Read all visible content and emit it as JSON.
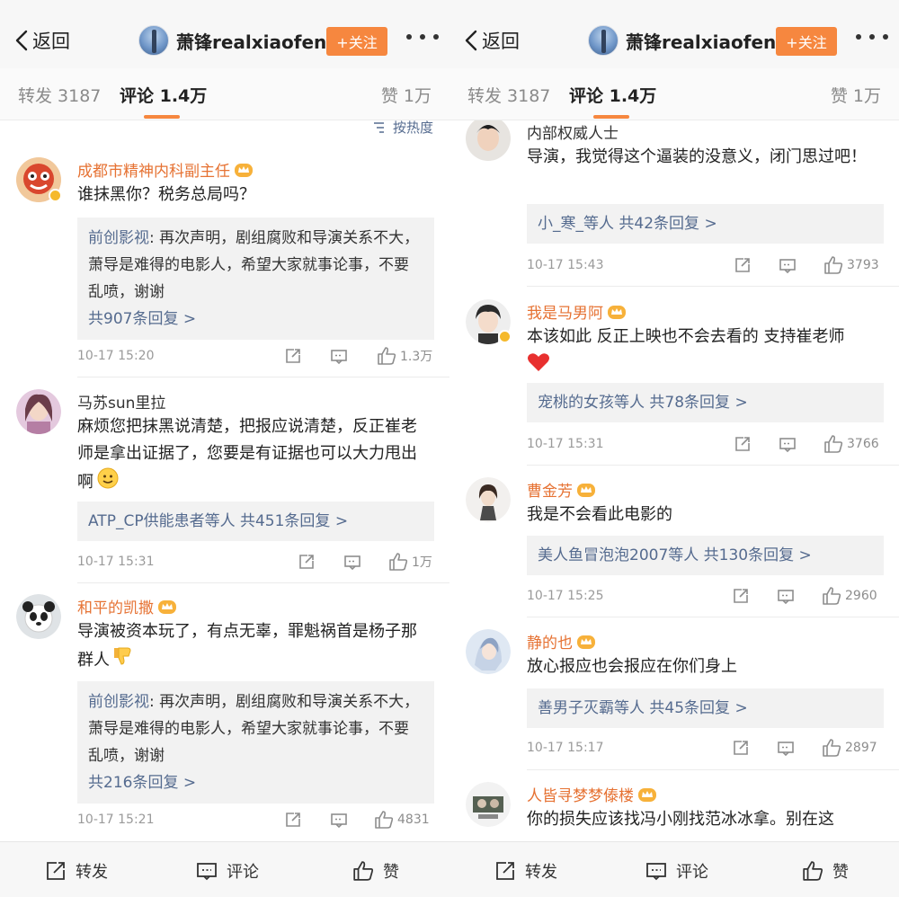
{
  "nav": {
    "back_label": "返回",
    "username": "萧锋realxiaofeng",
    "follow_label": "+关注"
  },
  "tabs": {
    "repost": "转发 3187",
    "comment": "评论 1.4万",
    "like": "赞 1万"
  },
  "sort_label": "按热度",
  "left": {
    "comments": [
      {
        "name": "成都市精神内科副主任",
        "text": "谁抹黑你？税务总局吗？",
        "reply_name": "前创影视",
        "reply_text": ": 再次声明，剧组腐败和导演关系不大，萧导是难得的电影人，希望大家就事论事，不要乱喷，谢谢",
        "reply_count": "共907条回复 >",
        "time": "10-17 15:20",
        "likes": "1.3万"
      },
      {
        "name": "马苏sun里拉",
        "text": "麻烦您把抹黑说清楚，把报应说清楚，反正崔老师是拿出证据了，您要是有证据也可以大力甩出啊",
        "reply_line": "ATP_CP供能患者等人  共451条回复 >",
        "time": "10-17 15:31",
        "likes": "1万"
      },
      {
        "name": "和平的凯撒",
        "text": "导演被资本玩了，有点无辜，罪魁祸首是杨子那群人",
        "reply_name": "前创影视",
        "reply_text": ": 再次声明，剧组腐败和导演关系不大，萧导是难得的电影人，希望大家就事论事，不要乱喷，谢谢",
        "reply_count": "共216条回复 >",
        "time": "10-17 15:21",
        "likes": "4831"
      }
    ]
  },
  "right": {
    "comments": [
      {
        "name": "内部权威人士",
        "text": "导演，我觉得这个逼装的没意义，闭门思过吧！",
        "reply_line": "小_寒_等人  共42条回复 >",
        "time": "10-17 15:43",
        "likes": "3793"
      },
      {
        "name": "我是马男阿",
        "text": "本该如此 反正上映也不会去看的 支持崔老师",
        "reply_line": "宠桃的女孩等人  共78条回复 >",
        "time": "10-17 15:31",
        "likes": "3766"
      },
      {
        "name": "曹金芳",
        "text": "我是不会看此电影的",
        "reply_line": "美人鱼冒泡泡2007等人  共130条回复 >",
        "time": "10-17 15:25",
        "likes": "2960"
      },
      {
        "name": "静的也",
        "text": "放心报应也会报应在你们身上",
        "reply_line": "善男子灭霸等人  共45条回复 >",
        "time": "10-17 15:17",
        "likes": "2897"
      },
      {
        "name": "人皆寻梦梦傣楼",
        "text": "你的损失应该找冯小刚找范冰冰拿。别在这"
      }
    ]
  },
  "bottom": {
    "repost": "转发",
    "comment": "评论",
    "like": "赞"
  },
  "colors": {
    "accent_orange": "#f6873f",
    "name_orange": "#e67233",
    "link_blue": "#556b8f"
  }
}
